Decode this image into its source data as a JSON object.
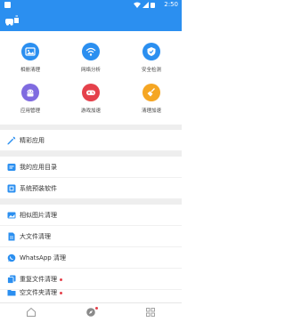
{
  "status_bar": {
    "time": "2:50"
  },
  "app_bar": {
    "title": ""
  },
  "grid": [
    {
      "label": "相册清理",
      "icon": "image-gallery-icon",
      "color": "#2b8ff0"
    },
    {
      "label": "网络分析",
      "icon": "wifi-icon",
      "color": "#2b8ff0"
    },
    {
      "label": "安全检测",
      "icon": "shield-icon",
      "color": "#2b8ff0"
    },
    {
      "label": "应用管理",
      "icon": "android-icon",
      "color": "#7f6be0"
    },
    {
      "label": "游戏加速",
      "icon": "gamepad-icon",
      "color": "#e5414b"
    },
    {
      "label": "清理加速",
      "icon": "broom-icon",
      "color": "#f5a623"
    }
  ],
  "section_featured": {
    "label": "精彩应用"
  },
  "list_a": [
    {
      "label": "我的应用目录",
      "icon": "app-catalog-icon"
    },
    {
      "label": "系统预装软件",
      "icon": "preinstalled-icon"
    }
  ],
  "list_b": [
    {
      "label": "相似图片清理",
      "icon": "similar-image-icon",
      "dot": false
    },
    {
      "label": "大文件清理",
      "icon": "large-file-icon",
      "dot": false
    },
    {
      "label": "WhatsApp 清理",
      "icon": "whatsapp-icon",
      "dot": false
    },
    {
      "label": "重复文件清理",
      "icon": "duplicate-file-icon",
      "dot": true
    },
    {
      "label": "空文件夹清理",
      "icon": "empty-folder-icon",
      "dot": true
    }
  ],
  "bottom_nav": [
    {
      "icon": "home-icon"
    },
    {
      "icon": "discover-icon",
      "dot": true
    },
    {
      "icon": "grid-apps-icon"
    }
  ]
}
